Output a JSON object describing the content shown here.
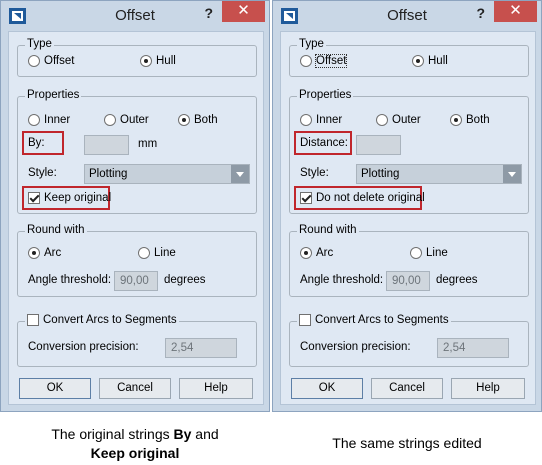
{
  "left_dialog": {
    "title": "Offset",
    "help_symbol": "?",
    "close_symbol": "✕",
    "type_group": {
      "title": "Type",
      "offset": "Offset",
      "hull": "Hull"
    },
    "properties_group": {
      "title": "Properties",
      "inner": "Inner",
      "outer": "Outer",
      "both": "Both",
      "by_label": "By:",
      "unit": "mm",
      "style_label": "Style:",
      "style_value": "Plotting",
      "keep_label": "Keep original"
    },
    "round_group": {
      "title": "Round with",
      "arc": "Arc",
      "line": "Line",
      "angle_label": "Angle threshold:",
      "angle_value": "90,00",
      "angle_unit": "degrees"
    },
    "convert_group": {
      "title": "Convert Arcs to Segments",
      "precision_label": "Conversion precision:",
      "precision_value": "2,54"
    },
    "buttons": {
      "ok": "OK",
      "cancel": "Cancel",
      "help": "Help"
    }
  },
  "right_dialog": {
    "title": "Offset",
    "help_symbol": "?",
    "close_symbol": "✕",
    "type_group": {
      "title": "Type",
      "offset": "Offset",
      "hull": "Hull"
    },
    "properties_group": {
      "title": "Properties",
      "inner": "Inner",
      "outer": "Outer",
      "both": "Both",
      "distance_label": "Distance:",
      "style_label": "Style:",
      "style_value": "Plotting",
      "keep_label": "Do not delete original"
    },
    "round_group": {
      "title": "Round with",
      "arc": "Arc",
      "line": "Line",
      "angle_label": "Angle threshold:",
      "angle_value": "90,00",
      "angle_unit": "degrees"
    },
    "convert_group": {
      "title": "Convert Arcs to Segments",
      "precision_label": "Conversion precision:",
      "precision_value": "2,54"
    },
    "buttons": {
      "ok": "OK",
      "cancel": "Cancel",
      "help": "Help"
    }
  },
  "captions": {
    "left_prefix": "The original strings ",
    "left_by": "By",
    "left_and": " and",
    "left_keep": "Keep original",
    "right": "The same strings edited"
  },
  "colors": {
    "highlight": "#c0262c",
    "close_button": "#c7504d",
    "accent": "#1f5a9a"
  }
}
